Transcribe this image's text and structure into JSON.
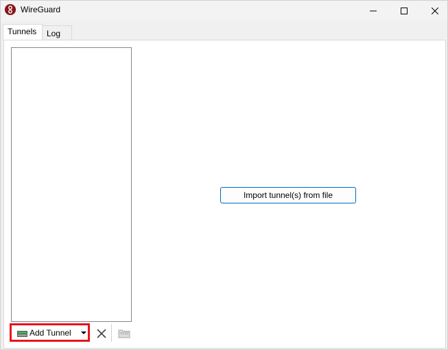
{
  "window": {
    "title": "WireGuard",
    "icon": "wireguard-logo-icon",
    "accent_color": "#88171a"
  },
  "caption_buttons": {
    "minimize_icon": "minimize-icon",
    "maximize_icon": "maximize-icon",
    "close_icon": "close-icon"
  },
  "tabs": [
    {
      "label": "Tunnels",
      "selected": true
    },
    {
      "label": "Log",
      "selected": false
    }
  ],
  "main": {
    "import_button_label": "Import tunnel(s) from file",
    "import_button_border_color": "#0067c0"
  },
  "toolbar": {
    "add_tunnel_label": "Add Tunnel",
    "add_tunnel_icon": "add-tunnel-icon",
    "add_tunnel_highlight_color": "#e8141c",
    "delete_icon": "delete-icon",
    "export_icon": "export-zip-icon"
  }
}
